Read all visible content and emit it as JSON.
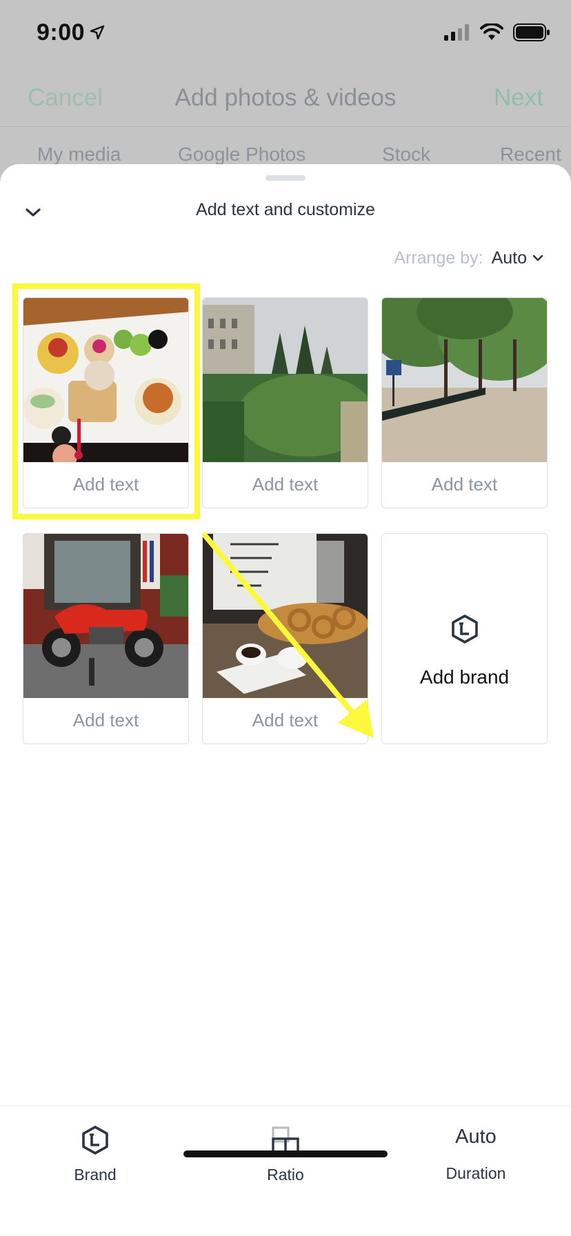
{
  "status_bar": {
    "time": "9:00"
  },
  "background_screen": {
    "cancel_label": "Cancel",
    "title": "Add photos & videos",
    "next_label": "Next",
    "tabs": [
      "My media",
      "Google Photos",
      "Stock",
      "Recent"
    ]
  },
  "sheet": {
    "title": "Add text and customize",
    "arrange_label": "Arrange by:",
    "arrange_value": "Auto"
  },
  "cards": [
    {
      "caption": "Add text",
      "photo": "tapas-plate"
    },
    {
      "caption": "Add text",
      "photo": "palace-garden"
    },
    {
      "caption": "Add text",
      "photo": "tree-lined-park"
    },
    {
      "caption": "Add text",
      "photo": "red-motorcycle"
    },
    {
      "caption": "Add text",
      "photo": "churros-and-coffee"
    }
  ],
  "brand_card": {
    "label": "Add brand",
    "icon": "brand-hexagon-icon"
  },
  "toolbar": {
    "brand_label": "Brand",
    "ratio_label": "Ratio",
    "duration_value": "Auto",
    "duration_label": "Duration"
  },
  "colors": {
    "annotation_yellow": "#fdf83b",
    "text_dark": "#2a3542",
    "caption_gray": "#8a96a3"
  }
}
